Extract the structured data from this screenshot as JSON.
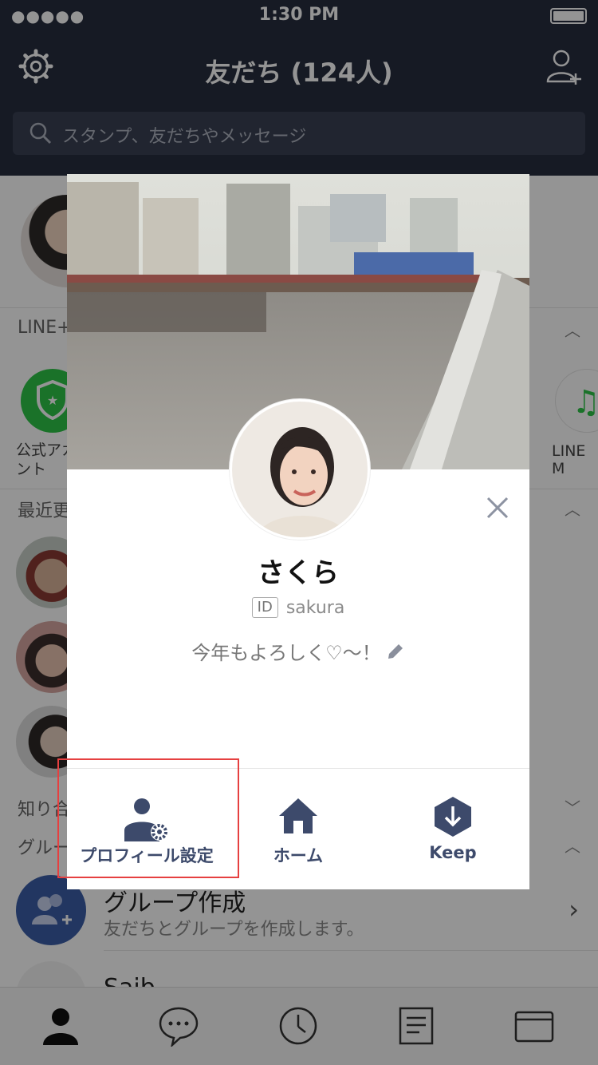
{
  "status_bar": {
    "signal": "●●●●●",
    "time": "1:30 PM"
  },
  "header": {
    "title": "友だち (124人)"
  },
  "search": {
    "placeholder": "スタンプ、友だちやメッセージ"
  },
  "sections": {
    "line_plus": "LINE+",
    "official_label": "公式アカウント",
    "music_label": "LINE M",
    "recent": "最近更",
    "known": "知り合",
    "groups": "グルー"
  },
  "group_create": {
    "title": "グループ作成",
    "subtitle": "友だちとグループを作成します。"
  },
  "last_friend": {
    "name": "Saib"
  },
  "profile": {
    "name": "さくら",
    "id_badge": "ID",
    "id": "sakura",
    "status": "今年もよろしく♡〜！",
    "actions": [
      {
        "label": "プロフィール設定",
        "icon": "profile-settings-icon"
      },
      {
        "label": "ホーム",
        "icon": "home-icon"
      },
      {
        "label": "Keep",
        "icon": "keep-icon"
      }
    ]
  },
  "colors": {
    "header_bg": "#262d3f",
    "accent_blue": "#3d4a6b",
    "official_green": "#2dc447",
    "highlight_red": "#e64040"
  }
}
